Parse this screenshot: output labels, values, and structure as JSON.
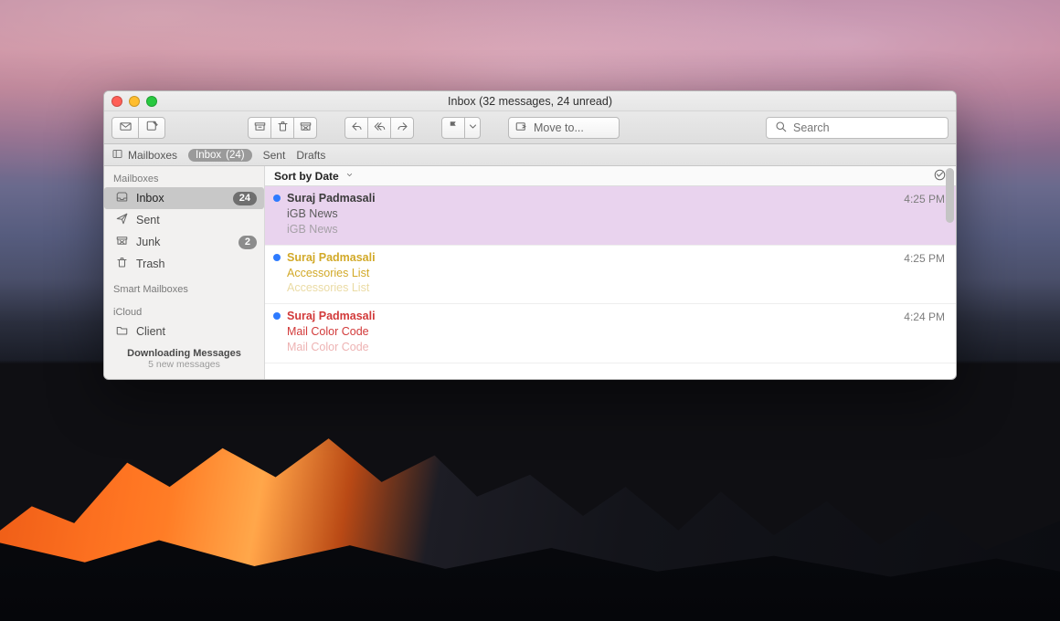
{
  "window": {
    "title": "Inbox (32 messages, 24 unread)"
  },
  "toolbar": {
    "move_to_label": "Move to...",
    "search_placeholder": "Search"
  },
  "favorites": {
    "mailboxes": "Mailboxes",
    "inbox_label": "Inbox",
    "inbox_count": "(24)",
    "sent": "Sent",
    "drafts": "Drafts"
  },
  "sidebar": {
    "header_mailboxes": "Mailboxes",
    "inbox": {
      "label": "Inbox",
      "badge": "24"
    },
    "sent": {
      "label": "Sent"
    },
    "junk": {
      "label": "Junk",
      "badge": "2"
    },
    "trash": {
      "label": "Trash"
    },
    "header_smart": "Smart Mailboxes",
    "header_icloud": "iCloud",
    "client": {
      "label": "Client"
    },
    "downloading": "Downloading Messages",
    "downloading_sub": "5 new messages"
  },
  "sort": {
    "label": "Sort by Date"
  },
  "messages": [
    {
      "from": "Suraj Padmasali",
      "subject": "iGB News",
      "preview": "iGB News",
      "time": "4:25 PM",
      "unread": true,
      "row_bg": "#e9d3ee",
      "text_color": "#3b3b3b",
      "subj_color": "#5b5b5b",
      "prev_color": "#8f8f8f",
      "dot_color": "#2e7bff"
    },
    {
      "from": "Suraj Padmasali",
      "subject": "Accessories List",
      "preview": "Accessories List",
      "time": "4:25 PM",
      "unread": true,
      "row_bg": "#ffffff",
      "text_color": "#d2a928",
      "subj_color": "#d2a928",
      "prev_color": "#e4cf86",
      "dot_color": "#2e7bff"
    },
    {
      "from": "Suraj Padmasali",
      "subject": "Mail Color Code",
      "preview": "Mail Color Code",
      "time": "4:24 PM",
      "unread": true,
      "row_bg": "#ffffff",
      "text_color": "#d23a3a",
      "subj_color": "#d23a3a",
      "prev_color": "#e89a9a",
      "dot_color": "#2e7bff"
    }
  ]
}
